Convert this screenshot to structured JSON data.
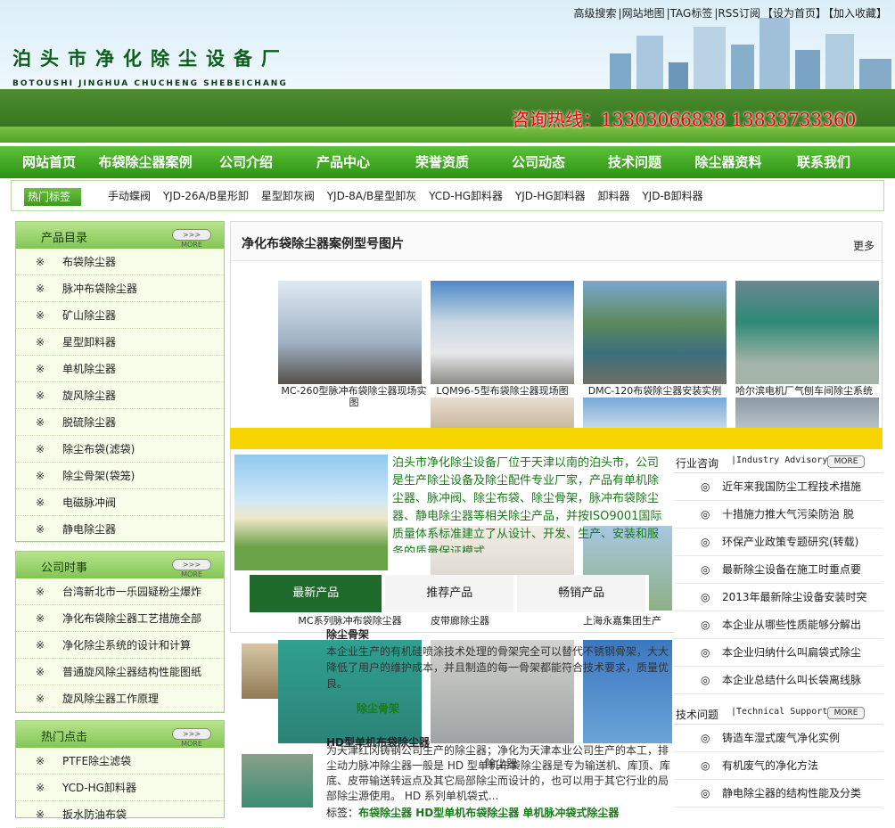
{
  "toplinks": [
    "高级搜索",
    "|网站地图",
    "|TAG标签",
    "|RSS订阅",
    "【设为首页】",
    "【加入收藏】"
  ],
  "logo": {
    "cn": "泊头市净化除尘设备厂",
    "en": "BOTOUSHI JINGHUA CHUCHENG SHEBEICHANG"
  },
  "hotline": "咨询热线：13303066838 13833733360",
  "nav": [
    "网站首页",
    "布袋除尘器案例",
    "公司介绍",
    "产品中心",
    "荣誉资质",
    "公司动态",
    "技术问题",
    "除尘器资料",
    "联系我们"
  ],
  "hottags": {
    "label": "热门标签",
    "tags": [
      "手动蝶阀",
      "YJD-26A/B星形卸",
      "星型卸灰阀",
      "YJD-8A/B星型卸灰",
      "YCD-HG卸料器",
      "YJD-HG卸料器",
      "卸料器",
      "YJD-B卸料器"
    ]
  },
  "sidebox_product": {
    "title": "产品目录",
    "more": ">>> MORE",
    "items": [
      "布袋除尘器",
      "脉冲布袋除尘器",
      "矿山除尘器",
      "星型卸料器",
      "单机除尘器",
      "旋风除尘器",
      "脱硫除尘器",
      "除尘布袋(滤袋)",
      "除尘骨架(袋笼)",
      "电磁脉冲阀",
      "静电除尘器"
    ]
  },
  "sidebox_news": {
    "title": "公司时事",
    "more": ">>> MORE",
    "items": [
      "台湾新北市一乐园疑粉尘爆炸",
      "净化布袋除尘器工艺措施全部",
      "净化除尘系统的设计和计算",
      "普通旋风除尘器结构性能图纸",
      "旋风除尘器工作原理"
    ]
  },
  "sidebox_hot": {
    "title": "热门点击",
    "more": ">>> MORE",
    "items": [
      "PTFE除尘滤袋",
      "YCD-HG卸料器",
      "扳水防油布袋"
    ]
  },
  "bullet": "※",
  "case": {
    "title": "净化布袋除尘器案例型号图片",
    "more": "更多",
    "row1": [
      "MC-260型脉冲布袋除尘器现场实图",
      "LQM96-5型布袋除尘器现场图",
      "DMC-120布袋除尘器安装实例",
      "哈尔滨电机厂气刨车间除尘系统"
    ],
    "row3": [
      "MC系列脉冲布袋除尘器",
      "皮带廊除尘器",
      "上海永嘉集团生产"
    ]
  },
  "about": "泊头市净化除尘设备厂位于天津以南的泊头市，公司是生产除尘设备及除尘配件专业厂家，产品有单机除尘器、脉冲阀、除尘布袋、除尘骨架，脉冲布袋除尘器、静电除尘器等相关除尘产品，并按ISO9001国际质量体系标准建立了从设计、开发、生产、安装和服务的质量保证模式。",
  "tabs": [
    "最新产品",
    "推荐产品",
    "畅销产品"
  ],
  "products": [
    {
      "name": "除尘骨架",
      "desc": "本企业生产的有机硅喷涂技术处理的骨架完全可以替代不锈钢骨架，大大降低了用户的维护成本，并且制造的每一骨架都能符合技术要求，质量优良。"
    },
    {
      "name": "除尘器",
      "desc": "除尘骨架"
    },
    {
      "name": "HD型单机布袋除尘器",
      "desc": "为天津红冈铸钢公司生产的除尘器；净化为天津本业公司生产的本工，排尘动力脉冲除尘器一般是 HD 型单机布袋除尘器是专为输送机、库顶、库底、皮带输送转运点及其它局部除尘而设计的，也可以用于其它行业的局部除尘源使用。 HD 系列单机袋式..."
    },
    {
      "name": "标签",
      "desc": "布袋除尘器 HD型单机布袋除尘器 单机脉冲袋式除尘器"
    }
  ],
  "advisory": {
    "title": "行业咨询",
    "en": "|Industry Advisory",
    "more": "MORE",
    "items": [
      "近年来我国防尘工程技术措施",
      "十措施力推大气污染防治 脱",
      "环保产业政策专题研究(转载)",
      "最新除尘设备在施工时重点要",
      "2013年最新除尘设备安装时突",
      "本企业从哪些性质能够分解出",
      "本企业归纳什么叫扁袋式除尘",
      "本企业总结什么叫长袋离线脉"
    ]
  },
  "support": {
    "title": "技术问题",
    "en": "|Technical Support",
    "more": "MORE",
    "items": [
      "铸造车湿式废气净化实例",
      "有机废气的净化方法",
      "静电除尘器的结构性能及分类"
    ]
  },
  "ring": "◎",
  "colors": {
    "nav": "#2c9212",
    "hotline": "#e00",
    "tabActive": "#1d6a2a",
    "yellow": "#f6d400"
  }
}
